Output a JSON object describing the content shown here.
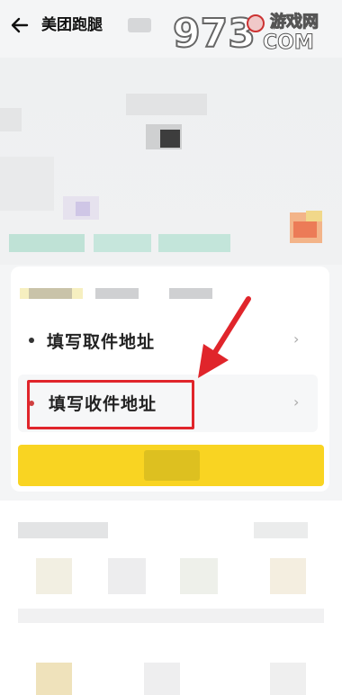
{
  "header": {
    "back_icon": "arrow-left-icon",
    "title": "美团跑腿"
  },
  "watermark": {
    "number": "973",
    "text_top": "游戏网",
    "text_bottom": "COM"
  },
  "address_rows": [
    {
      "label": "填写取件地址"
    },
    {
      "label": "填写收件地址"
    }
  ],
  "chevron": "›",
  "colors": {
    "accent_yellow": "#f9d422",
    "highlight_red": "#e0252b",
    "background": "#f4f5f6"
  }
}
